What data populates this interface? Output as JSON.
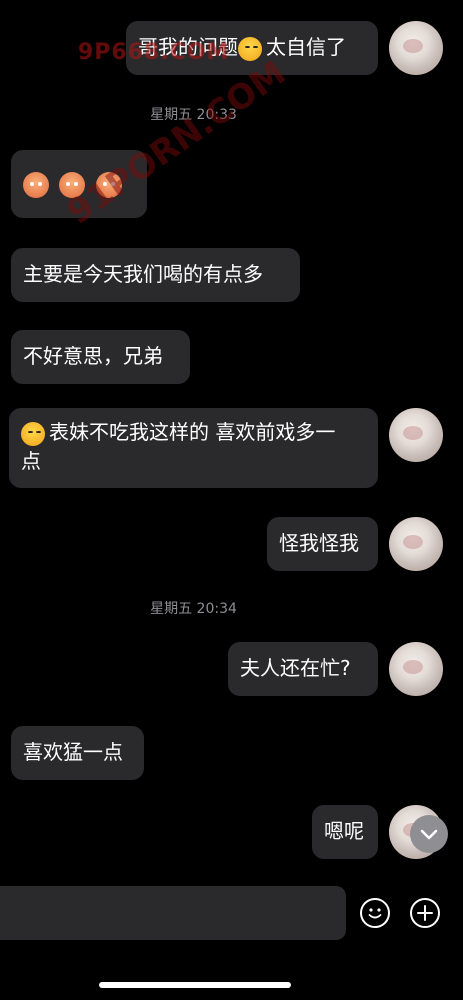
{
  "messages": [
    {
      "side": "right",
      "text": "哥我的问题😂太自信了"
    },
    {
      "type": "timestamp",
      "text": "星期五 20:33"
    },
    {
      "side": "left",
      "text": "😵😵😵"
    },
    {
      "side": "left",
      "text": "主要是今天我们喝的有点多"
    },
    {
      "side": "left",
      "text": "不好意思，兄弟"
    },
    {
      "side": "left",
      "text_line1": "😂表妹不吃我这样的 喜欢前戏多一",
      "text_line2": "点"
    },
    {
      "side": "right",
      "text": "怪我怪我"
    },
    {
      "type": "timestamp",
      "text": "星期五 20:34"
    },
    {
      "side": "right",
      "text": "夫人还在忙?"
    },
    {
      "side": "left",
      "text": "喜欢猛一点"
    },
    {
      "side": "right",
      "text": "嗯呢"
    }
  ],
  "watermarks": {
    "top": "9P668.COM",
    "diagonal": "91PORN.COM"
  },
  "icons": {
    "emoji_button": "smile-icon",
    "add_button": "plus-icon",
    "scroll_button": "chevron-down-icon"
  }
}
